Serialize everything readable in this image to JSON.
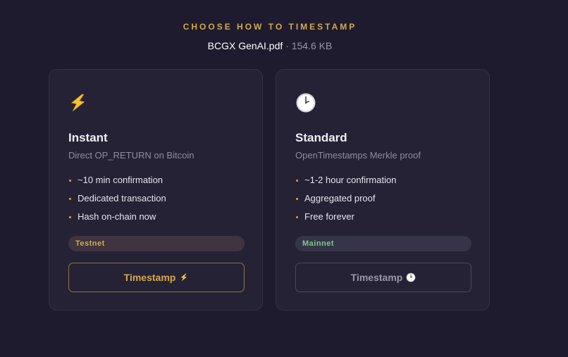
{
  "header": {
    "title": "CHOOSE HOW TO TIMESTAMP",
    "file_name": "BCGX GenAI.pdf",
    "separator": "·",
    "file_size": "154.6 KB"
  },
  "options": [
    {
      "icon": "lightning-icon",
      "title": "Instant",
      "subtitle": "Direct OP_RETURN on Bitcoin",
      "features": [
        "~10 min confirmation",
        "Dedicated transaction",
        "Hash on-chain now"
      ],
      "network": "Testnet",
      "button_label": "Timestamp",
      "button_icon": "lightning-icon"
    },
    {
      "icon": "clock-icon",
      "title": "Standard",
      "subtitle": "OpenTimestamps Merkle proof",
      "features": [
        "~1-2 hour confirmation",
        "Aggregated proof",
        "Free forever"
      ],
      "network": "Mainnet",
      "button_label": "Timestamp",
      "button_icon": "clock-icon"
    }
  ],
  "colors": {
    "background": "#1e1b2e",
    "card": "#252236",
    "accent_gold": "#d4a94c",
    "mainnet_green": "#7dc98a",
    "muted_text": "#8f8aa4"
  }
}
